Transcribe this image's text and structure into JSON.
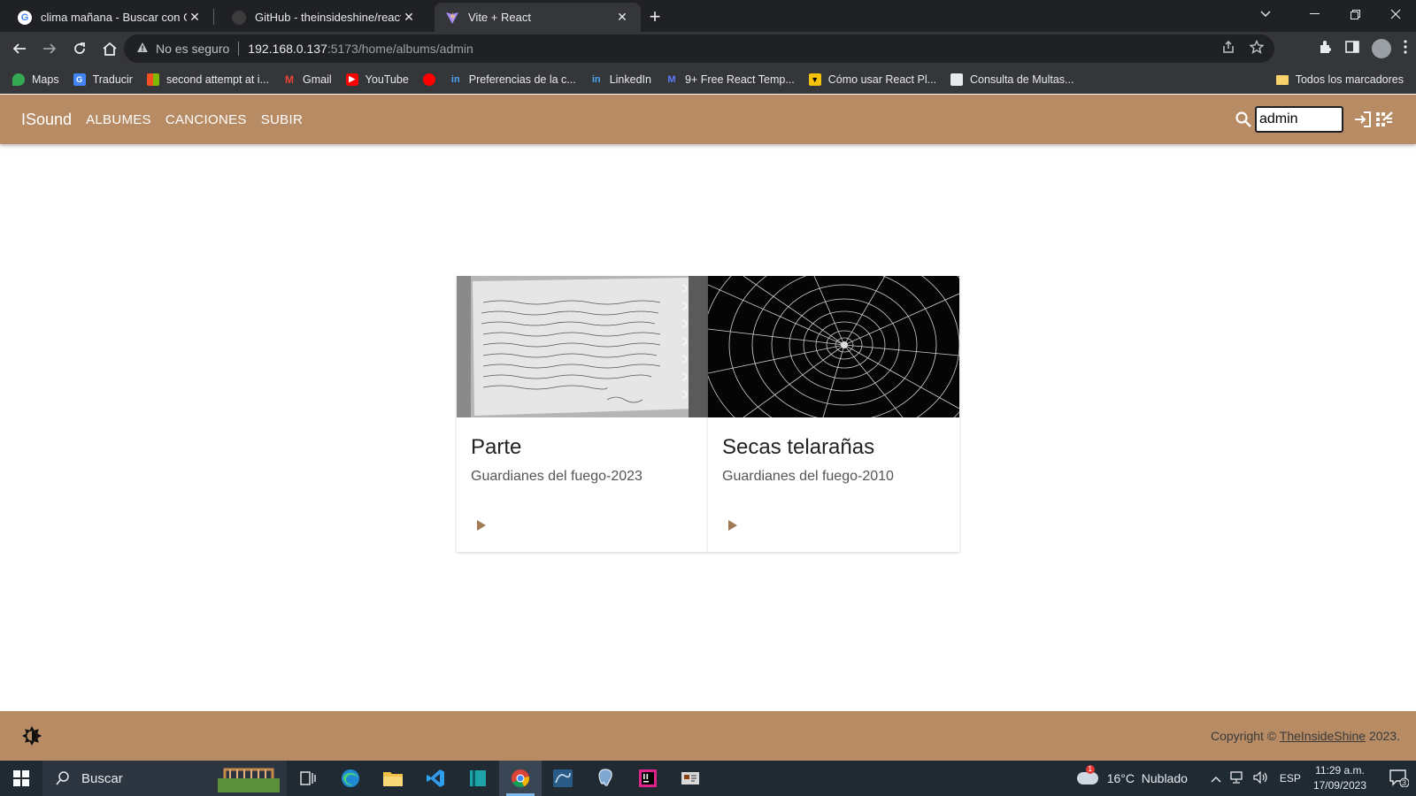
{
  "browser": {
    "tabs": [
      {
        "label": "clima mañana - Buscar con Goog",
        "icon": "google-icon",
        "active": false
      },
      {
        "label": "GitHub - theinsideshine/react-ins",
        "icon": "github-icon",
        "active": false
      },
      {
        "label": "Vite + React",
        "icon": "vite-icon",
        "active": true
      }
    ],
    "close_glyph": "✕",
    "new_tab_glyph": "+",
    "address": {
      "security_label": "No es seguro",
      "host": "192.168.0.137",
      "path": ":5173/home/albums/admin"
    },
    "bookmarks": [
      {
        "label": "Maps",
        "color": "#34a853"
      },
      {
        "label": "Traducir",
        "color": "#4285f4"
      },
      {
        "label": "second attempt at i...",
        "color": "#f25022"
      },
      {
        "label": "Gmail",
        "color": "#ea4335"
      },
      {
        "label": "YouTube",
        "color": "#ff0000"
      },
      {
        "label": "",
        "color": "#ff0000"
      },
      {
        "label": "Preferencias de la c...",
        "color": "#0a66c2"
      },
      {
        "label": "LinkedIn",
        "color": "#0a66c2"
      },
      {
        "label": "9+ Free React Temp...",
        "color": "#3b5bdb"
      },
      {
        "label": "Cómo usar React Pl...",
        "color": "#f4c20d"
      },
      {
        "label": "Consulta de Multas...",
        "color": "#e8eaed"
      }
    ],
    "all_bookmarks_label": "Todos los marcadores"
  },
  "app": {
    "brand": "ISound",
    "nav": [
      {
        "label": "ALBUMES"
      },
      {
        "label": "CANCIONES"
      },
      {
        "label": "SUBIR"
      }
    ],
    "search_value": "admin",
    "accent_color": "#b78b64"
  },
  "albums": [
    {
      "title": "Parte",
      "subtitle": "Guardianes del fuego-2023",
      "image": "handwritten-notebook"
    },
    {
      "title": "Secas telarañas",
      "subtitle": "Guardianes del fuego-2010",
      "image": "spider-web"
    }
  ],
  "footer": {
    "copyright_prefix": "Copyright ©",
    "copyright_link": "TheInsideShine",
    "copyright_year": "2023."
  },
  "taskbar": {
    "search_placeholder": "Buscar",
    "weather": "16°C  Nublado",
    "weather_badge": "1",
    "language": "ESP",
    "time": "11:29 a.m.",
    "date": "17/09/2023",
    "notification_count": "3"
  }
}
